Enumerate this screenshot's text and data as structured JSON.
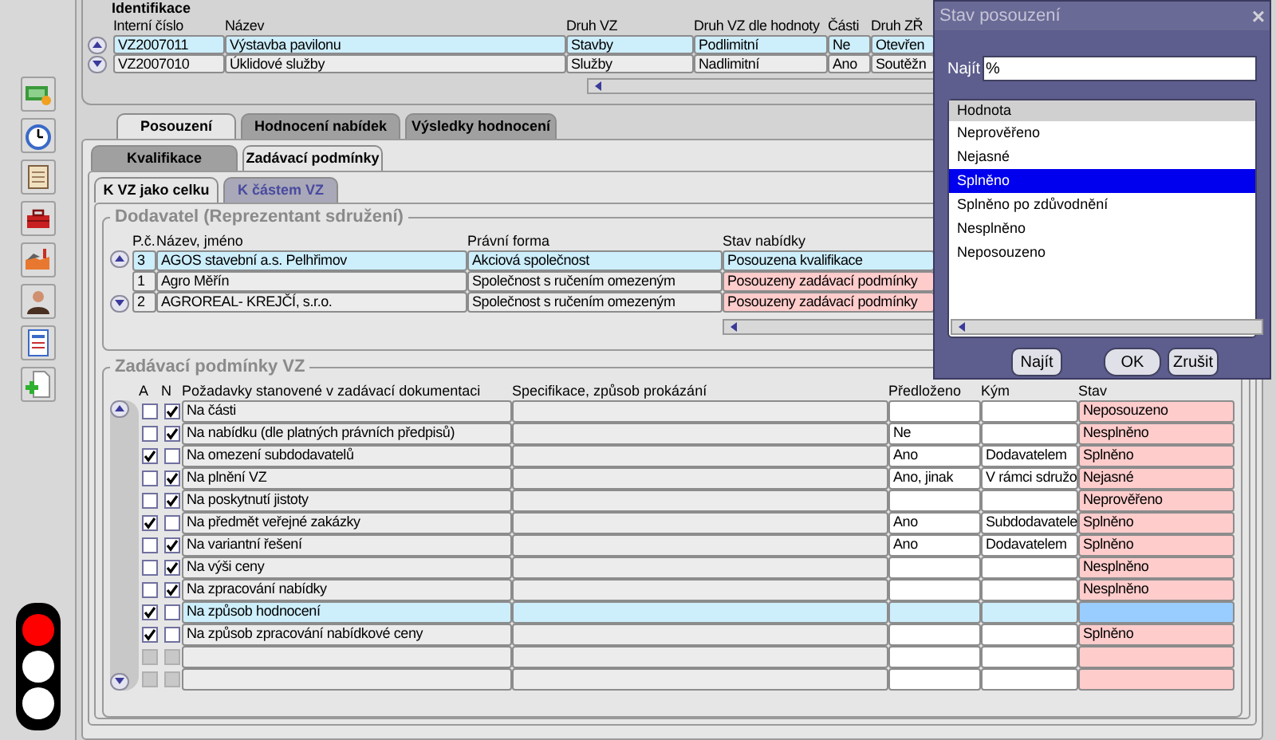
{
  "identification": {
    "title": "Identifikace",
    "columns": [
      "Interní číslo",
      "Název",
      "Druh VZ",
      "Druh VZ dle hodnoty",
      "Části",
      "Druh ZŘ"
    ],
    "rows": [
      {
        "selected": true,
        "cells": [
          "VZ2007011",
          "Výstavba pavilonu",
          "Stavby",
          "Podlimitní",
          "Ne",
          "Otevřen"
        ]
      },
      {
        "selected": false,
        "cells": [
          "VZ2007010",
          "Úklidové služby",
          "Služby",
          "Nadlimitní",
          "Ano",
          "Soutěžn"
        ]
      }
    ]
  },
  "tabs": [
    {
      "label": "Posouzení",
      "selected": true
    },
    {
      "label": "Hodnocení nabídek",
      "selected": false
    },
    {
      "label": "Výsledky hodnocení",
      "selected": false
    }
  ],
  "subtabs": [
    {
      "label": "Kvalifikace",
      "selected": false
    },
    {
      "label": "Zadávací podmínky",
      "selected": true
    }
  ],
  "scope_tabs": [
    {
      "label": "K VZ jako celku",
      "selected": true
    },
    {
      "label": "K částem VZ",
      "selected": false
    }
  ],
  "suppliers": {
    "title": "Dodavatel (Reprezentant sdružení)",
    "columns": [
      "P.č.",
      "Název, jméno",
      "Právní forma",
      "Stav nabídky"
    ],
    "rows": [
      {
        "selected": true,
        "cells": [
          "3",
          "AGOS stavební a.s. Pelhřimov",
          "Akciová společnost",
          "Posouzena kvalifikace"
        ]
      },
      {
        "selected": false,
        "cells": [
          "1",
          "Agro Měřín",
          "Společnost s ručením omezeným",
          "Posouzeny zadávací podmínky"
        ]
      },
      {
        "selected": false,
        "cells": [
          "2",
          "AGROREAL- KREJČÍ, s.r.o.",
          "Společnost s ručením omezeným",
          "Posouzeny zadávací podmínky"
        ]
      }
    ]
  },
  "conditions": {
    "title": "Zadávací podmínky VZ",
    "columns": [
      "A",
      "N",
      "Požadavky stanovené v zadávací dokumentaci",
      "Specifikace, způsob prokázání",
      "Předloženo",
      "Kým",
      "Stav"
    ],
    "rows": [
      {
        "a": false,
        "n": true,
        "disabled": false,
        "selected": false,
        "requirement": "Na části",
        "submitted": "",
        "by": "",
        "status": "Neposouzeno"
      },
      {
        "a": false,
        "n": true,
        "disabled": false,
        "selected": false,
        "requirement": "Na nabídku (dle platných právních předpisů)",
        "submitted": "Ne",
        "by": "",
        "status": "Nesplněno"
      },
      {
        "a": true,
        "n": false,
        "disabled": false,
        "selected": false,
        "requirement": "Na omezení subdodavatelů",
        "submitted": "Ano",
        "by": "Dodavatelem",
        "status": "Splněno"
      },
      {
        "a": false,
        "n": true,
        "disabled": false,
        "selected": false,
        "requirement": "Na plnění VZ",
        "submitted": "Ano, jinak",
        "by": "V rámci sdružo",
        "status": "Nejasné"
      },
      {
        "a": false,
        "n": true,
        "disabled": false,
        "selected": false,
        "requirement": "Na poskytnutí jistoty",
        "submitted": "",
        "by": "",
        "status": "Neprověřeno"
      },
      {
        "a": true,
        "n": false,
        "disabled": false,
        "selected": false,
        "requirement": "Na předmět veřejné zakázky",
        "submitted": "Ano",
        "by": "Subdodavatele",
        "status": "Splněno"
      },
      {
        "a": false,
        "n": true,
        "disabled": false,
        "selected": false,
        "requirement": "Na variantní řešení",
        "submitted": "Ano",
        "by": "Dodavatelem",
        "status": "Splněno"
      },
      {
        "a": false,
        "n": true,
        "disabled": false,
        "selected": false,
        "requirement": "Na výši ceny",
        "submitted": "",
        "by": "",
        "status": "Nesplněno"
      },
      {
        "a": false,
        "n": true,
        "disabled": false,
        "selected": false,
        "requirement": "Na zpracování nabídky",
        "submitted": "",
        "by": "",
        "status": "Nesplněno"
      },
      {
        "a": true,
        "n": false,
        "disabled": false,
        "selected": true,
        "requirement": "Na způsob hodnocení",
        "submitted": "",
        "by": "",
        "status": ""
      },
      {
        "a": true,
        "n": false,
        "disabled": false,
        "selected": false,
        "requirement": "Na způsob zpracování nabídkové ceny",
        "submitted": "",
        "by": "",
        "status": "Splněno"
      },
      {
        "a": false,
        "n": false,
        "disabled": true,
        "selected": false,
        "requirement": "",
        "submitted": "",
        "by": "",
        "status": ""
      },
      {
        "a": false,
        "n": false,
        "disabled": true,
        "selected": false,
        "requirement": "",
        "submitted": "",
        "by": "",
        "status": ""
      }
    ]
  },
  "traffic_light": {
    "lights": [
      {
        "on": true
      },
      {
        "on": false
      },
      {
        "on": false
      }
    ]
  },
  "dialog": {
    "title": "Stav posouzení",
    "close": "×",
    "search_label": "Najít",
    "search_value": "%",
    "list_header": "Hodnota",
    "items": [
      {
        "label": "Neprověřeno",
        "selected": false
      },
      {
        "label": "Nejasné",
        "selected": false
      },
      {
        "label": "Splněno",
        "selected": true
      },
      {
        "label": "Splněno po zdůvodnění",
        "selected": false
      },
      {
        "label": "Nesplněno",
        "selected": false
      },
      {
        "label": "Neposouzeno",
        "selected": false
      }
    ],
    "buttons": [
      "Najít",
      "OK",
      "Zrušit"
    ]
  }
}
